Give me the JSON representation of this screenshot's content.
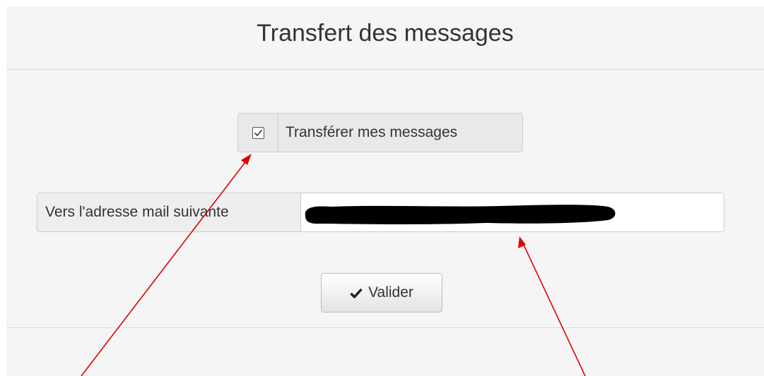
{
  "panel": {
    "title": "Transfert des messages"
  },
  "forward": {
    "checked": true,
    "label": "Transférer mes messages"
  },
  "email": {
    "label": "Vers l'adresse mail suivante",
    "value": ""
  },
  "submit": {
    "label": "Valider",
    "icon": "check-icon"
  },
  "colors": {
    "annotation_arrow": "#e00000",
    "panel_background": "#f5f5f5"
  }
}
